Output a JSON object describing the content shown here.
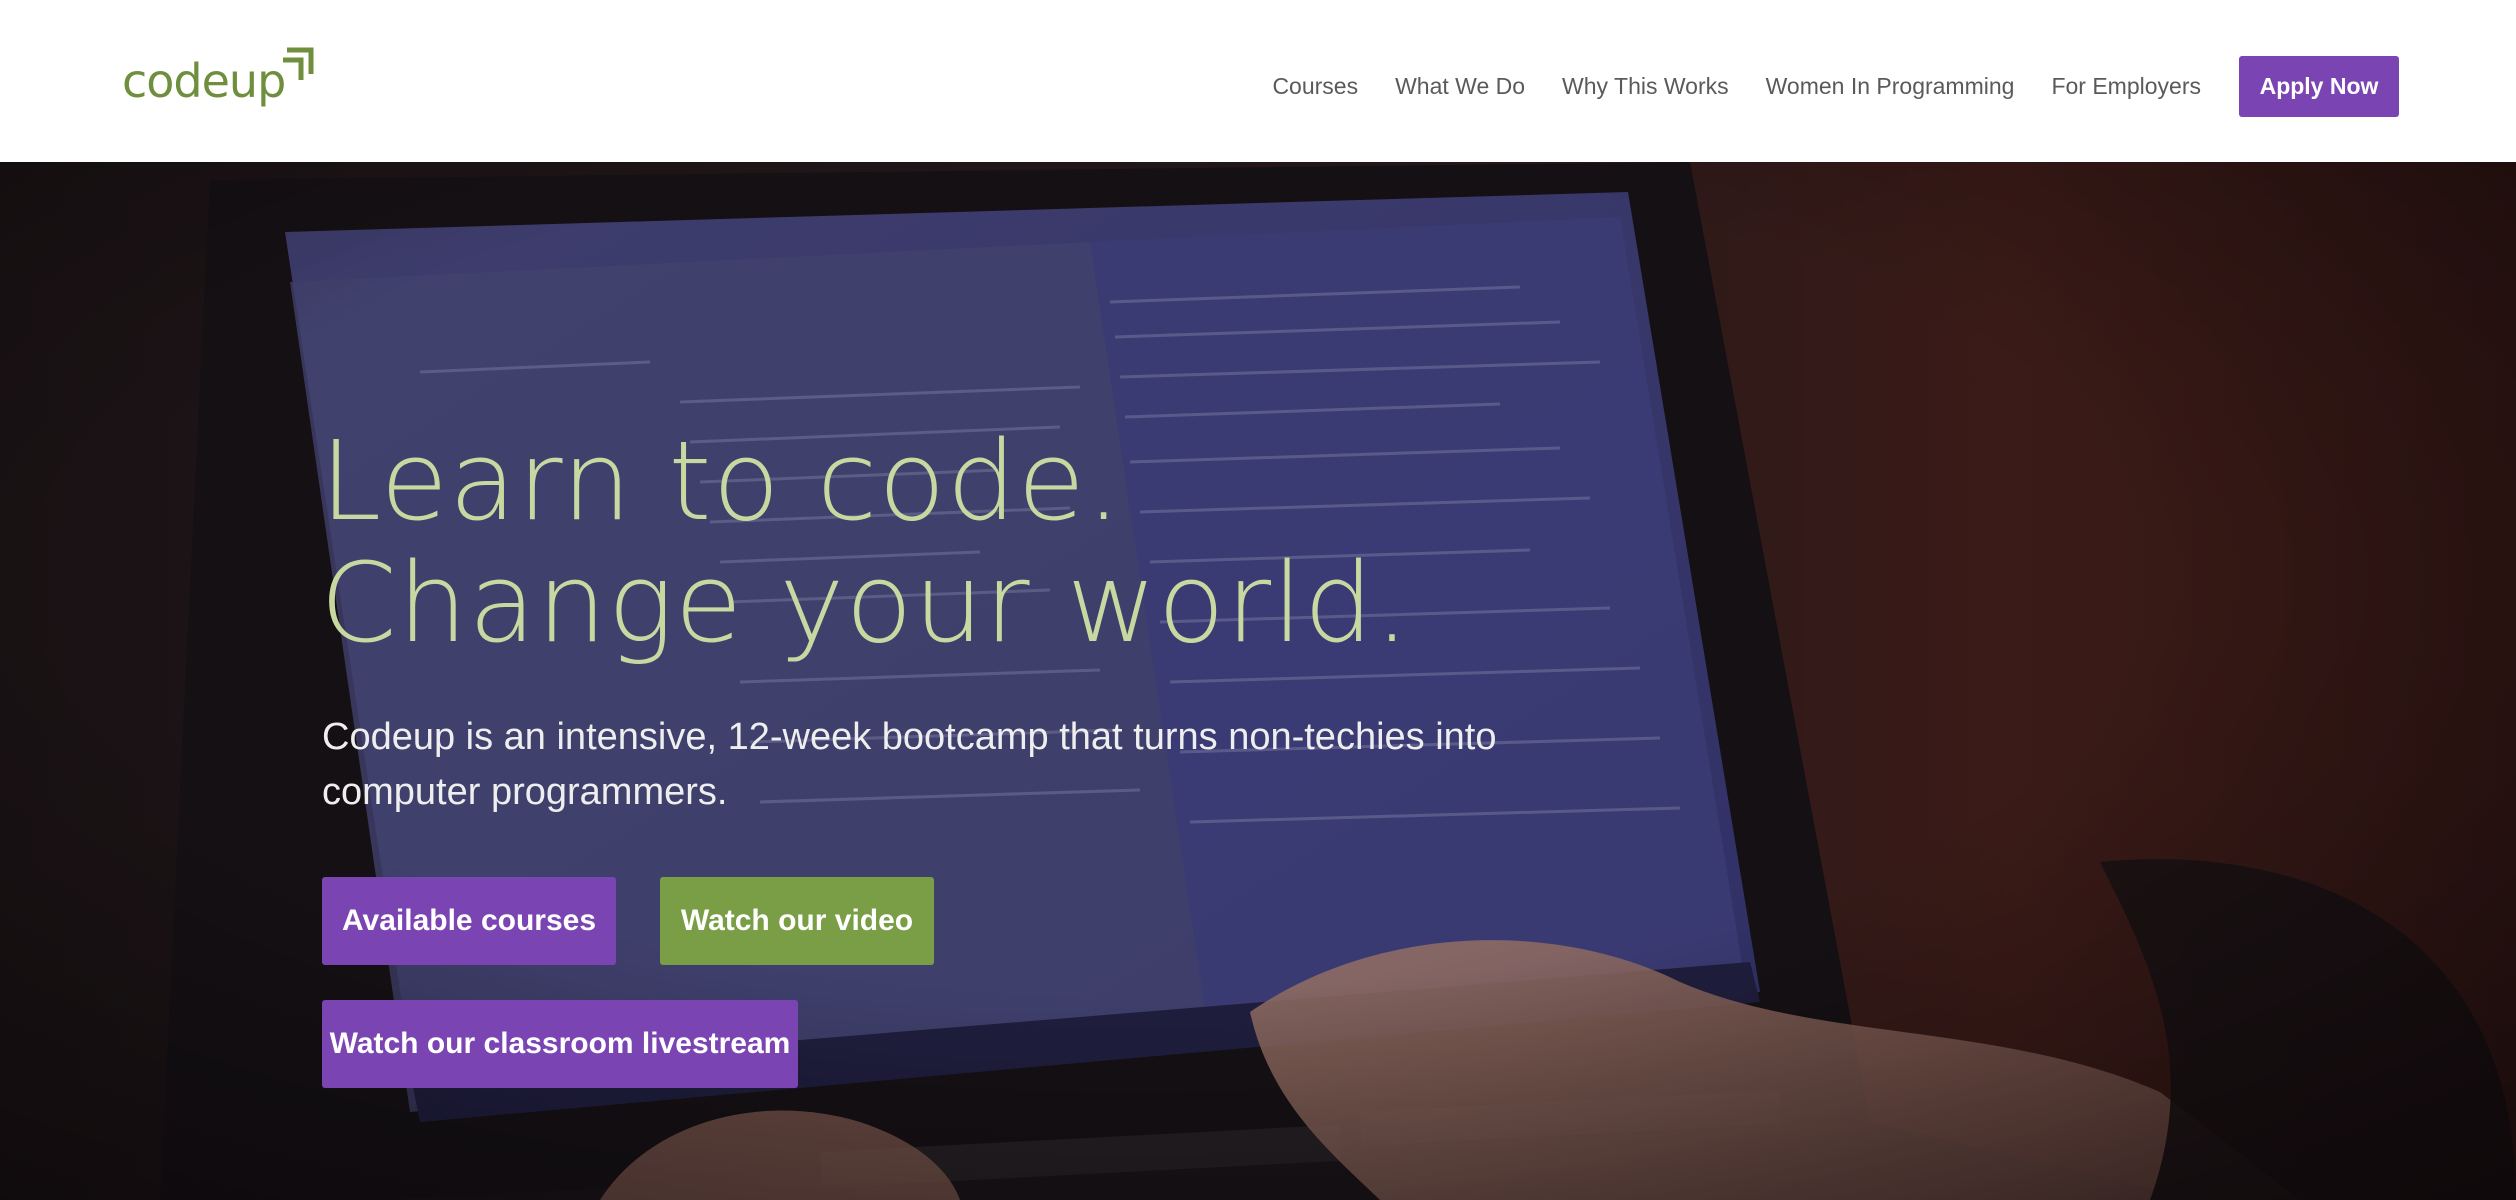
{
  "header": {
    "logo_text": "codeup",
    "nav": [
      {
        "label": "Courses"
      },
      {
        "label": "What We Do"
      },
      {
        "label": "Why This Works"
      },
      {
        "label": "Women In Programming"
      },
      {
        "label": "For Employers"
      }
    ],
    "apply_label": "Apply Now"
  },
  "hero": {
    "headline_line1": "Learn to code.",
    "headline_line2": "Change your world.",
    "subtext": "Codeup is an intensive, 12-week bootcamp that turns non-techies into computer programmers.",
    "buttons": {
      "courses": "Available courses",
      "video": "Watch our video",
      "livestream": "Watch our classroom livestream"
    }
  },
  "colors": {
    "brand_purple": "#7a45b3",
    "brand_green": "#7a9e45",
    "logo_green": "#6f8f3e",
    "headline_green": "#c7d9a0"
  },
  "icons": {
    "logo_mark": "chevron-arrow-icon"
  }
}
